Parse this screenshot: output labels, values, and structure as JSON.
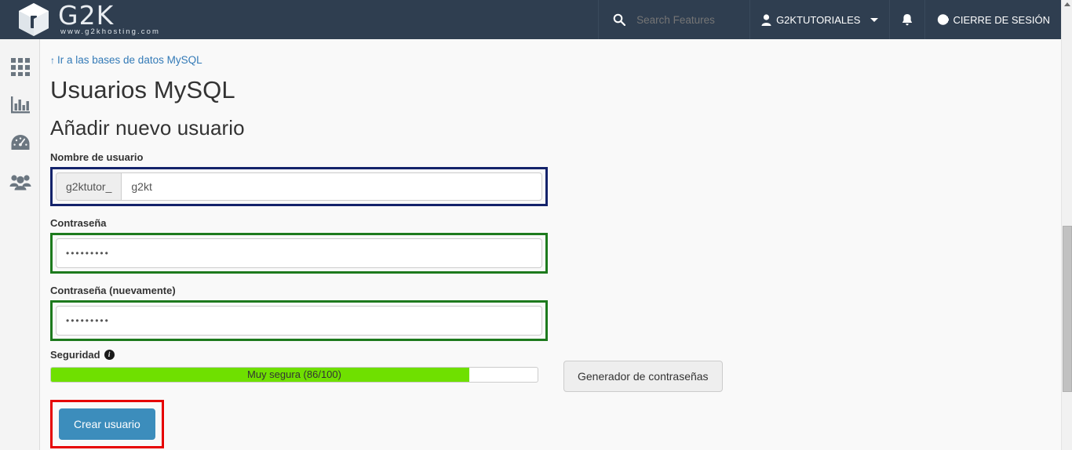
{
  "header": {
    "brand": {
      "logo_icon": "cube-logo-icon",
      "word": "G2K",
      "url": "www.g2khosting.com"
    },
    "search": {
      "icon": "search-icon",
      "placeholder": "Search Features",
      "value": ""
    },
    "account": {
      "icon": "user-icon",
      "label": "G2KTUTORIALES",
      "caret_icon": "chevron-down-icon"
    },
    "notifications": {
      "icon": "bell-icon"
    },
    "logout": {
      "icon": "logout-icon",
      "label": "CIERRE DE SESIÓN"
    }
  },
  "sidebar": {
    "items": [
      {
        "icon": "grid-apps-icon",
        "name": "apps"
      },
      {
        "icon": "bar-chart-icon",
        "name": "statistics"
      },
      {
        "icon": "gauge-icon",
        "name": "metrics"
      },
      {
        "icon": "users-icon",
        "name": "users"
      }
    ]
  },
  "main": {
    "breadcrumb": {
      "arrow": "↑",
      "label": "Ir a las bases de datos MySQL"
    },
    "page_title": "Usuarios MySQL",
    "section_title": "Añadir nuevo usuario",
    "username": {
      "label": "Nombre de usuario",
      "prefix": "g2ktutor_",
      "value": "g2kt",
      "placeholder": ""
    },
    "password": {
      "label": "Contraseña",
      "value": "•••••••••",
      "placeholder": ""
    },
    "password_confirm": {
      "label": "Contraseña (nuevamente)",
      "value": "•••••••••",
      "placeholder": ""
    },
    "strength": {
      "label": "Seguridad",
      "info_icon": "info-circle-icon",
      "text": "Muy segura (86/100)",
      "score": 86,
      "max": 100,
      "percent": 86
    },
    "generator_button": "Generador de contraseñas",
    "submit_button": "Crear usuario"
  },
  "annotations": {
    "username_box_color": "#14236b",
    "password_box_color": "#1d7a1d",
    "submit_box_color": "#e60000"
  },
  "colors": {
    "header_bg": "#2f3e50",
    "sidebar_bg": "#f4f4f4",
    "content_bg": "#f9f9f9",
    "link": "#337ab7",
    "primary_button": "#3c8dbc",
    "meter_fill": "#6fe000"
  },
  "scrollbar": {
    "up_arrow_icon": "scroll-up-arrow-icon",
    "thumb": "scroll-thumb"
  }
}
